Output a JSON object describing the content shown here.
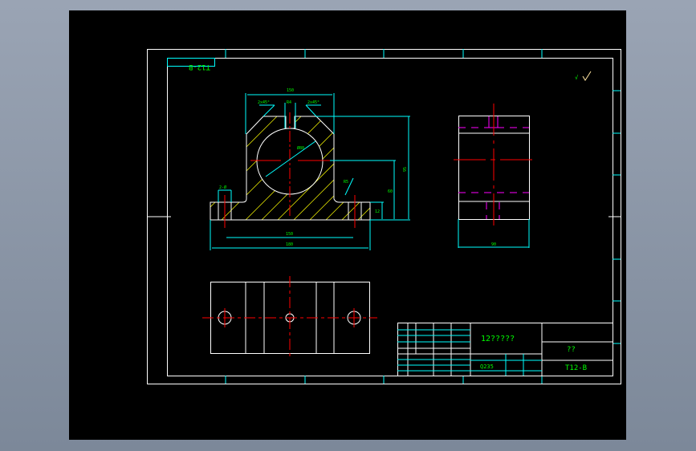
{
  "drawing": {
    "code": "T12-B",
    "code_mirrored": "T12-B",
    "part_name": "12?????",
    "company": "??",
    "material": "Q235",
    "roughness_symbol": "surface-finish-icon"
  },
  "colors": {
    "background": "#000000",
    "outline": "#ffffff",
    "dimension": "#00ffff",
    "center": "#ff0000",
    "hidden": "#ff00ff",
    "hatch": "#ffff00",
    "text": "#00ff00"
  }
}
